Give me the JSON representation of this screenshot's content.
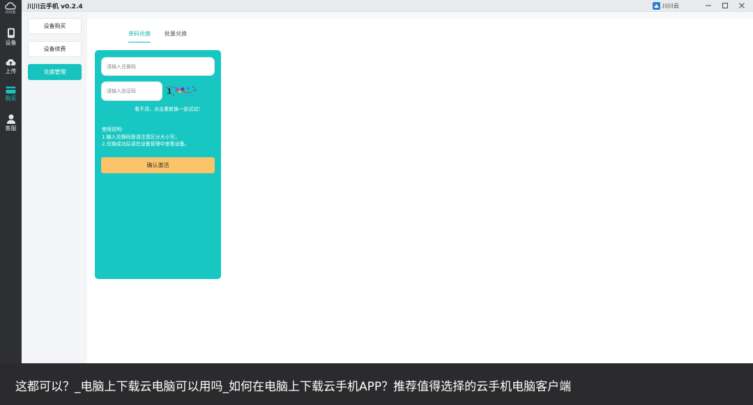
{
  "app": {
    "title": "川川云手机 v0.2.4",
    "logo_text": "川川云",
    "brand_label": "川川云"
  },
  "leftbar": {
    "items": [
      {
        "label": "设备",
        "icon": "phone-icon"
      },
      {
        "label": "上传",
        "icon": "cloud-upload-icon"
      },
      {
        "label": "购买",
        "icon": "card-icon"
      },
      {
        "label": "客服",
        "icon": "support-icon"
      }
    ]
  },
  "subnav": {
    "items": [
      {
        "label": "设备购买"
      },
      {
        "label": "设备续费"
      },
      {
        "label": "兑换管理"
      }
    ]
  },
  "tabs": [
    {
      "label": "单码兑换"
    },
    {
      "label": "批量兑换"
    }
  ],
  "form": {
    "code_placeholder": "请输入兑换码",
    "captcha_placeholder": "请输入验证码",
    "captcha_text": "1",
    "refresh_hint": "看不清，点击重新换一张试试！",
    "usage_title": "使用说明:",
    "usage_line1": "1.输入兑换码是请注意区分大小写；",
    "usage_line2": "2.兑换成功后请在设备管理中查看设备。",
    "confirm_label": "确认激活"
  },
  "caption": {
    "text": "这都可以？_电脑上下载云电脑可以用吗_如何在电脑上下载云手机APP？推荐值得选择的云手机电脑客户端"
  },
  "colors": {
    "accent": "#18c7c1",
    "confirm": "#fbc46b",
    "sidebar": "#2d2f33"
  }
}
